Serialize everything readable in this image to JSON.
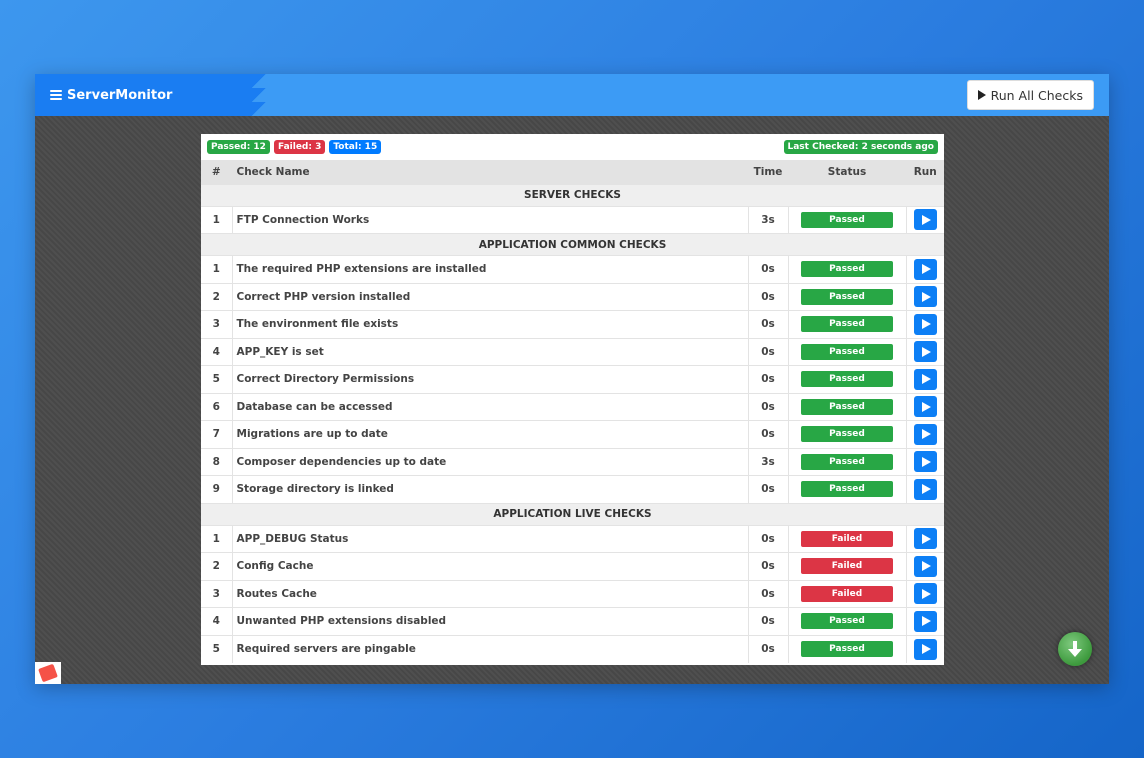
{
  "app": {
    "brand": "ServerMonitor",
    "run_all_label": "Run All Checks"
  },
  "summary": {
    "passed": "Passed: 12",
    "failed": "Failed: 3",
    "total": "Total: 15",
    "last_checked": "Last Checked: 2 seconds ago"
  },
  "table": {
    "headers": {
      "num": "#",
      "name": "Check Name",
      "time": "Time",
      "status": "Status",
      "run": "Run"
    },
    "sections": [
      {
        "title": "SERVER CHECKS",
        "rows": [
          {
            "num": "1",
            "name": "FTP Connection Works",
            "time": "3s",
            "status": "Passed"
          }
        ]
      },
      {
        "title": "APPLICATION COMMON CHECKS",
        "rows": [
          {
            "num": "1",
            "name": "The required PHP extensions are installed",
            "time": "0s",
            "status": "Passed"
          },
          {
            "num": "2",
            "name": "Correct PHP version installed",
            "time": "0s",
            "status": "Passed"
          },
          {
            "num": "3",
            "name": "The environment file exists",
            "time": "0s",
            "status": "Passed"
          },
          {
            "num": "4",
            "name": "APP_KEY is set",
            "time": "0s",
            "status": "Passed"
          },
          {
            "num": "5",
            "name": "Correct Directory Permissions",
            "time": "0s",
            "status": "Passed"
          },
          {
            "num": "6",
            "name": "Database can be accessed",
            "time": "0s",
            "status": "Passed"
          },
          {
            "num": "7",
            "name": "Migrations are up to date",
            "time": "0s",
            "status": "Passed"
          },
          {
            "num": "8",
            "name": "Composer dependencies up to date",
            "time": "3s",
            "status": "Passed"
          },
          {
            "num": "9",
            "name": "Storage directory is linked",
            "time": "0s",
            "status": "Passed"
          }
        ]
      },
      {
        "title": "APPLICATION LIVE CHECKS",
        "rows": [
          {
            "num": "1",
            "name": "APP_DEBUG Status",
            "time": "0s",
            "status": "Failed"
          },
          {
            "num": "2",
            "name": "Config Cache",
            "time": "0s",
            "status": "Failed"
          },
          {
            "num": "3",
            "name": "Routes Cache",
            "time": "0s",
            "status": "Failed"
          },
          {
            "num": "4",
            "name": "Unwanted PHP extensions disabled",
            "time": "0s",
            "status": "Passed"
          },
          {
            "num": "5",
            "name": "Required servers are pingable",
            "time": "0s",
            "status": "Passed"
          }
        ]
      }
    ]
  },
  "colors": {
    "brand": "#1a7df2",
    "navbar": "#3c9bf5",
    "passed": "#28a745",
    "failed": "#dc3545",
    "run_button": "#0d7ff5"
  },
  "icons": {
    "brand": "server-icon",
    "run_all": "play-icon",
    "run_row": "play-icon",
    "scroll": "arrow-down-icon",
    "corner": "laravel-logo-icon"
  }
}
